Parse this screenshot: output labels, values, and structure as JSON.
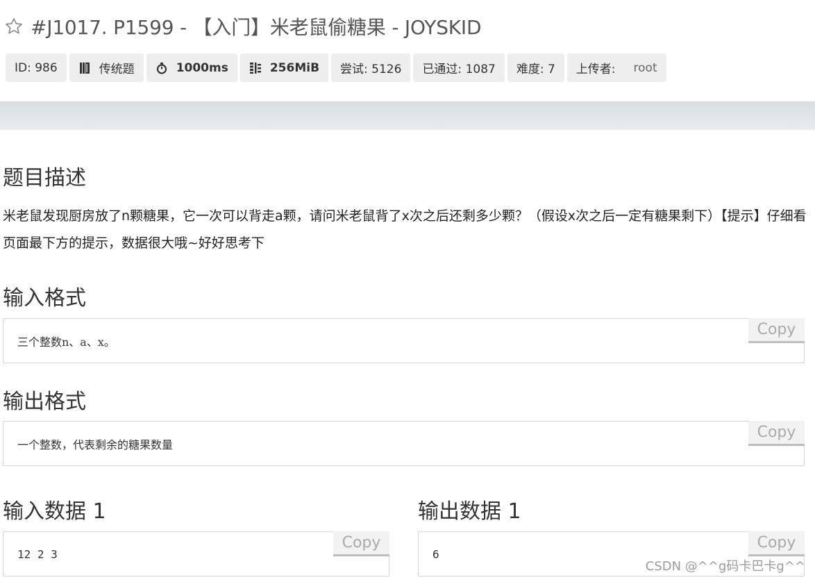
{
  "header": {
    "title": "#J1017. P1599 - 【入门】米老鼠偷糖果 - JOYSKID",
    "star_icon": "star-outline-icon"
  },
  "meta": {
    "id": "ID: 986",
    "type": "传统题",
    "time_limit": "1000ms",
    "memory_limit": "256MiB",
    "attempts": "尝试: 5126",
    "accepted": "已通过: 1087",
    "difficulty": "难度: 7",
    "uploader_label": "上传者:",
    "uploader": "root"
  },
  "sections": {
    "description_heading": "题目描述",
    "description_text": "米老鼠发现厨房放了n颗糖果，它一次可以背走a颗，请问米老鼠背了x次之后还剩多少颗？（假设x次之后一定有糖果剩下）【提示】仔细看页面最下方的提示，数据很大哦~好好思考下",
    "input_heading": "输入格式",
    "input_text": "三个整数n、a、x。",
    "output_heading": "输出格式",
    "output_text": "一个整数，代表剩余的糖果数量",
    "sample_input_heading": "输入数据 1",
    "sample_input": "12 2 3",
    "sample_output_heading": "输出数据 1",
    "sample_output": "6"
  },
  "buttons": {
    "copy_label": "Copy"
  },
  "watermark": "CSDN @^^g码卡巴卡g^^",
  "colors": {
    "meta_bg": "#eeeeee",
    "band": "#dfe4e7",
    "copy_text": "#aaaaaa"
  }
}
